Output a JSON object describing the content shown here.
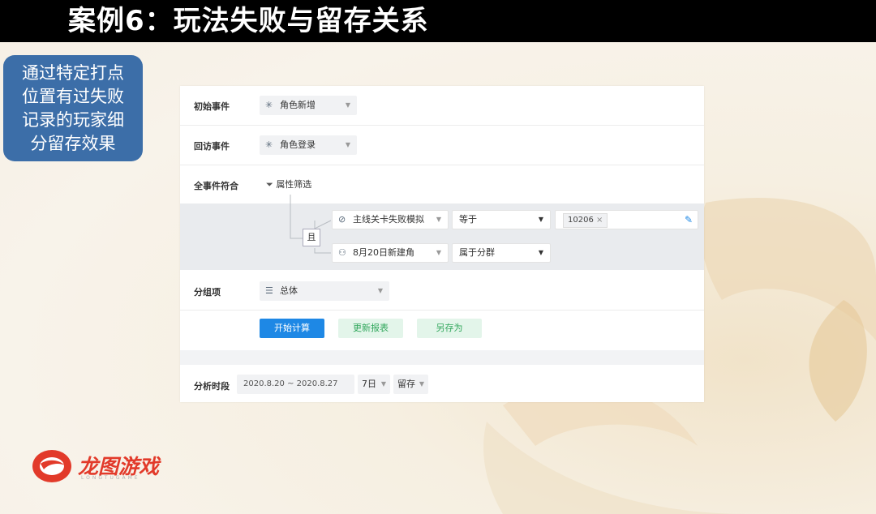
{
  "slide": {
    "title": "案例6：玩法失败与留存关系",
    "callout_lines": [
      "通过特定打点",
      "位置有过失败",
      "记录的玩家细",
      "分留存效果"
    ]
  },
  "form": {
    "initial_event": {
      "label": "初始事件",
      "value": "角色新增"
    },
    "return_event": {
      "label": "回访事件",
      "value": "角色登录"
    },
    "all_events": {
      "label": "全事件符合",
      "filter_link": "属性筛选"
    },
    "conditions": {
      "logic": "且",
      "rows": [
        {
          "field": "主线关卡失败模拟",
          "operator": "等于",
          "value": "10206"
        },
        {
          "field": "8月20日新建角",
          "operator": "属于分群"
        }
      ]
    },
    "group_by": {
      "label": "分组项",
      "value": "总体"
    },
    "buttons": {
      "start": "开始计算",
      "update": "更新报表",
      "save_as": "另存为"
    },
    "period": {
      "label": "分析时段",
      "range": "2020.8.20 ~ 2020.8.27",
      "days": "7日",
      "metric": "留存"
    }
  },
  "logo": {
    "name": "龙图游戏",
    "subtitle": "LONGTUGAME"
  },
  "colors": {
    "primary_blue": "#1e88e5",
    "callout_blue": "#3c6ea8",
    "green_btn": "#e3f5ea",
    "green_text": "#31a75c",
    "logo_red": "#e23a2a"
  }
}
